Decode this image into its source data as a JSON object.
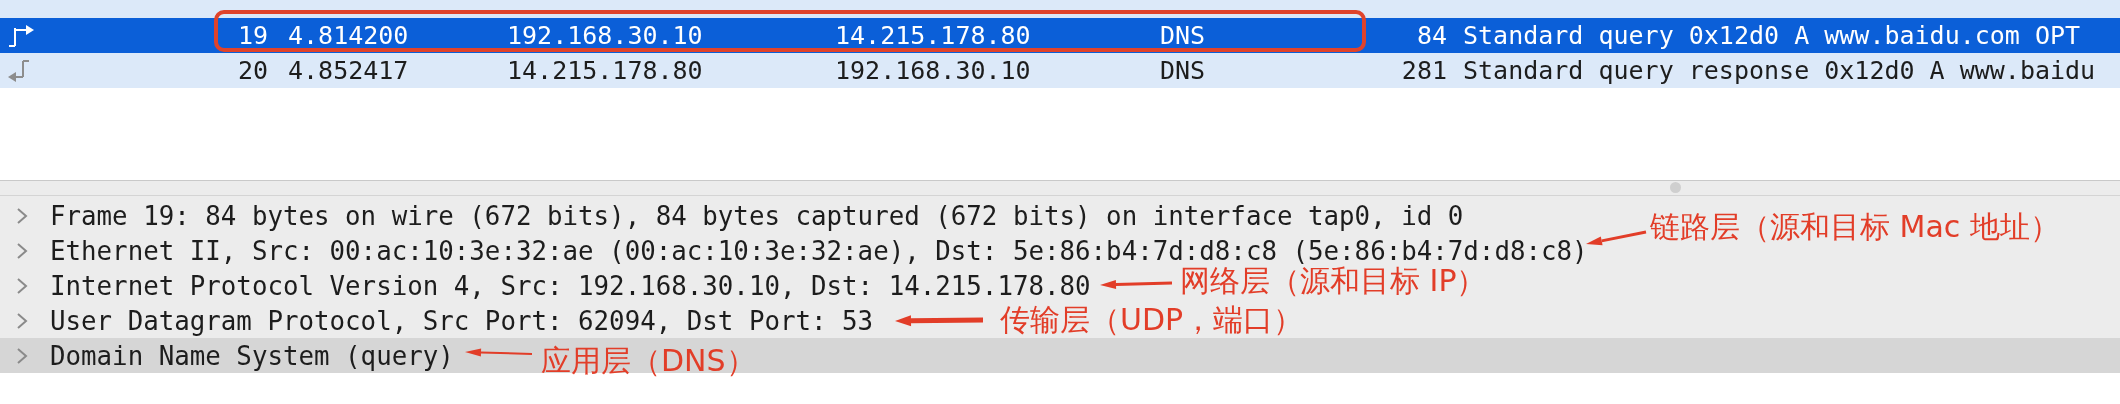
{
  "packet_list": {
    "rows": [
      {
        "no": "19",
        "time": "4.814200",
        "source": "192.168.30.10",
        "destination": "14.215.178.80",
        "protocol": "DNS",
        "length": "84",
        "info": "Standard query 0x12d0 A www.baidu.com OPT",
        "kind": "request",
        "selected": true,
        "outlined": true
      },
      {
        "no": "20",
        "time": "4.852417",
        "source": "14.215.178.80",
        "destination": "192.168.30.10",
        "protocol": "DNS",
        "length": "281",
        "info": "Standard query response 0x12d0 A www.baidu",
        "kind": "response",
        "selected": false,
        "outlined": false
      }
    ]
  },
  "packet_details": {
    "rows": [
      {
        "text": "Frame 19: 84 bytes on wire (672 bits), 84 bytes captured (672 bits) on interface tap0, id 0",
        "expanded": false,
        "selected": false
      },
      {
        "text": "Ethernet II, Src: 00:ac:10:3e:32:ae (00:ac:10:3e:32:ae), Dst: 5e:86:b4:7d:d8:c8 (5e:86:b4:7d:d8:c8)",
        "expanded": false,
        "selected": false
      },
      {
        "text": "Internet Protocol Version 4, Src: 192.168.30.10, Dst: 14.215.178.80",
        "expanded": false,
        "selected": false
      },
      {
        "text": "User Datagram Protocol, Src Port: 62094, Dst Port: 53",
        "expanded": false,
        "selected": false
      },
      {
        "text": "Domain Name System (query)",
        "expanded": false,
        "selected": true
      }
    ]
  },
  "annotations": [
    {
      "text": "链路层（源和目标 Mac 地址）"
    },
    {
      "text": "网络层（源和目标 IP）"
    },
    {
      "text": "传输层（UDP，端口）"
    },
    {
      "text": "应用层（DNS）"
    }
  ]
}
